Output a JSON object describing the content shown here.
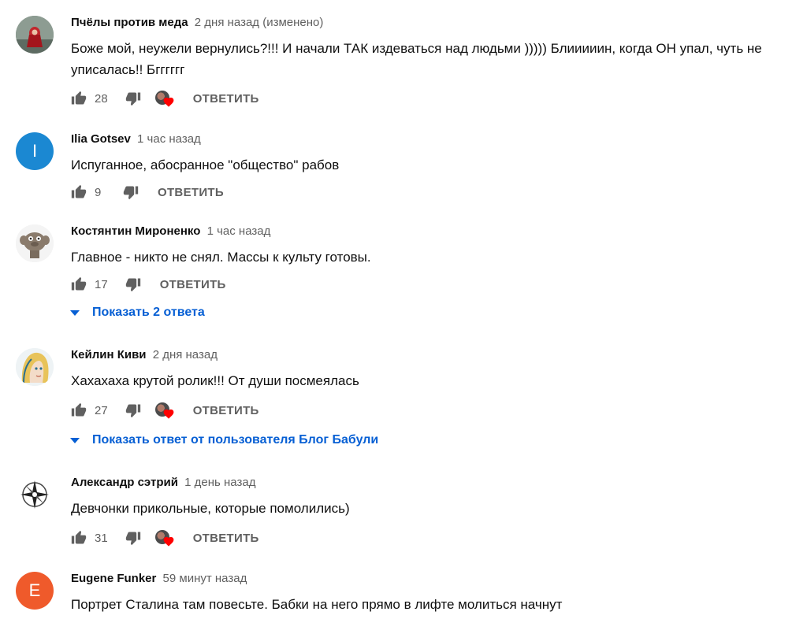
{
  "ui": {
    "reply_label": "ОТВЕТИТЬ",
    "colors": {
      "link": "#065fd4",
      "secondary": "#606060"
    }
  },
  "comments": [
    {
      "author": "Пчёлы против меда",
      "time": "2 дня назад (изменено)",
      "text": "Боже мой, неужели вернулись?!!!  И начали ТАК издеваться над людьми ))))) Блииииин, когда ОН упал, чуть не уписалась!! Бгггггг",
      "likes": "28",
      "creator_heart": true,
      "avatar": "red-hood-picture"
    },
    {
      "author": "Ilia Gotsev",
      "time": "1 час назад",
      "text": "Испуганное, абосранное \"общество\" рабов",
      "likes": "9",
      "creator_heart": false,
      "avatar_letter": "I",
      "avatar_color": "#1b88d2"
    },
    {
      "author": "Костянтин Мироненко",
      "time": "1 час назад",
      "text": "Главное - никто не снял. Массы к культу готовы.",
      "likes": "17",
      "creator_heart": false,
      "avatar": "cartoon-face-picture",
      "show_replies": "Показать 2 ответа"
    },
    {
      "author": "Кейлин Киви",
      "time": "2 дня назад",
      "text": "Хахахаха крутой ролик!!! От души посмеялась",
      "likes": "27",
      "creator_heart": true,
      "avatar": "blonde-girl-drawing",
      "show_replies": "Показать ответ от пользователя Блог Бабули"
    },
    {
      "author": "Александр сэтрий",
      "time": "1 день назад",
      "text": "Девчонки прикольные, которые помолились)",
      "likes": "31",
      "creator_heart": true,
      "avatar": "compass-star-emblem"
    },
    {
      "author": "Eugene Funker",
      "time": "59 минут назад",
      "text": "Портрет Сталина там повесьте. Бабки на него прямо в лифте молиться начнут",
      "avatar_letter": "E",
      "avatar_color": "#ef5a2b"
    }
  ]
}
